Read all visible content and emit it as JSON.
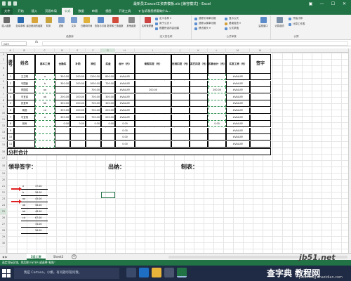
{
  "titlebar": {
    "title": "最新员工excel工资表模板.xls [兼容模式] - Excel"
  },
  "tabs": [
    "文件",
    "开始",
    "插入",
    "页面布局",
    "公式",
    "数据",
    "审阅",
    "视图",
    "开发工具",
    "♀ 告诉我您想要做什么..."
  ],
  "ribbon": {
    "function_library": {
      "label": "函数库",
      "buttons": [
        "插入函数",
        "自动求和",
        "最近使用的函数",
        "财务",
        "逻辑",
        "文本",
        "日期和时间",
        "查找与引用",
        "数学和三角函数",
        "其他函数"
      ]
    },
    "defined_names": {
      "label": "定义的名称",
      "manager": "名称管理器",
      "items": [
        "定义名称 ▾",
        "用于公式 ▾",
        "根据所选内容创建"
      ]
    },
    "formula_auditing": {
      "label": "公式审核",
      "items": [
        "追踪引用单元格",
        "追踪从属单元格",
        "移去箭头 ▾",
        "显示公式",
        "错误检查 ▾",
        "公式求值"
      ],
      "watch": "监视窗口"
    },
    "calculation": {
      "label": "计算",
      "options": "计算选项",
      "items": [
        "开始计算",
        "计算工作表"
      ]
    }
  },
  "formula_bar": {
    "name_box": "G25",
    "fx": "fx",
    "formula": ""
  },
  "columns": [
    "A",
    "B",
    "C",
    "D",
    "E",
    "F",
    "G",
    "H",
    "I",
    "J",
    "K",
    "L",
    "M",
    "N"
  ],
  "rows": [
    "1",
    "2",
    "3",
    "4",
    "5",
    "6",
    "7",
    "8",
    "9",
    "10",
    "11",
    "12",
    "13",
    "14",
    "15",
    "16",
    "17",
    "18",
    "19",
    "20",
    "21",
    "22",
    "23",
    "24",
    "25",
    "26",
    "27",
    "28",
    "29",
    "30"
  ],
  "table": {
    "headers": {
      "no": "序号",
      "name": "姓名",
      "base": "基本工资",
      "full_attend": "全勤奖",
      "subsidy": "补助",
      "post": "岗位",
      "bonus": "奖金",
      "total": "合计（元）",
      "late": "请假扣发（元）",
      "absent": "迟到扣发（元）",
      "other": "其它扣发（元）",
      "deduct_total": "扣款合计（元）",
      "actual": "实发工资（元）",
      "sign": "签字"
    },
    "rows": [
      {
        "no": "1",
        "name": "王卫明",
        "base": "a",
        "full": "350.00",
        "subsidy": "200.00",
        "post": "1200.00",
        "bonus": "800.00",
        "total": "#VALUE!",
        "late": "",
        "absent": "",
        "other": "",
        "deduct": "",
        "actual": "#VALUE!"
      },
      {
        "no": "2",
        "name": "乌国鑫",
        "base": "b",
        "full": "350.00",
        "subsidy": "200.00",
        "post": "1000.00",
        "bonus": "700.00",
        "total": "#VALUE!",
        "late": "",
        "absent": "",
        "other": "",
        "deduct": "",
        "actual": "#VALUE!"
      },
      {
        "no": "3",
        "name": "郑国斌",
        "base": "aa",
        "full": "",
        "subsidy": "",
        "post": "700.00",
        "bonus": "",
        "total": "#VALUE!",
        "late": "200.00",
        "absent": "",
        "other": "",
        "deduct": "200.00",
        "actual": "#VALUE!"
      },
      {
        "no": "4",
        "name": "乌宜省",
        "base": "ab",
        "full": "200.00",
        "subsidy": "200.00",
        "post": "700.00",
        "bonus": "300.00",
        "total": "#VALUE!",
        "late": "",
        "absent": "",
        "other": "",
        "deduct": "",
        "actual": "#VALUE!"
      },
      {
        "no": "5",
        "name": "张爱琴",
        "base": "bb",
        "full": "350.00",
        "subsidy": "200.00",
        "post": "700.00",
        "bonus": "300.00",
        "total": "#VALUE!",
        "late": "",
        "absent": "",
        "other": "",
        "deduct": "",
        "actual": "#VALUE!"
      },
      {
        "no": "6",
        "name": "蒋园",
        "base": "cd",
        "full": "350.00",
        "subsidy": "200.00",
        "post": "700.00",
        "bonus": "200.00",
        "total": "#VALUE!",
        "late": "",
        "absent": "",
        "other": "",
        "deduct": "",
        "actual": "#VALUE!"
      },
      {
        "no": "7",
        "name": "乌宜宿",
        "base": "a",
        "full": "350.00",
        "subsidy": "200.00",
        "post": "700.00",
        "bonus": "200.00",
        "total": "#VALUE!",
        "late": "",
        "absent": "",
        "other": "",
        "deduct": "",
        "actual": "#VALUE!"
      },
      {
        "no": "8",
        "name": "宫睿",
        "base": "",
        "full": "0.00",
        "subsidy": "0.00",
        "post": "0.00",
        "bonus": "0.00",
        "total": "0.00",
        "late": "",
        "absent": "",
        "other": "",
        "deduct": "0.00",
        "actual": "#VALUE!"
      },
      {
        "no": "9",
        "name": "",
        "base": "",
        "full": "",
        "subsidy": "",
        "post": "",
        "bonus": "",
        "total": "0.00",
        "late": "",
        "absent": "",
        "other": "",
        "deduct": "",
        "actual": "#VALUE!"
      },
      {
        "no": "10",
        "name": "",
        "base": "",
        "full": "",
        "subsidy": "",
        "post": "",
        "bonus": "",
        "total": "0.00",
        "late": "",
        "absent": "",
        "other": "",
        "deduct": "",
        "actual": "#VALUE!"
      },
      {
        "no": "11",
        "name": "",
        "base": "",
        "full": "",
        "subsidy": "",
        "post": "",
        "bonus": "",
        "total": "0.00",
        "late": "",
        "absent": "",
        "other": "",
        "deduct": "",
        "actual": "#VALUE!"
      }
    ],
    "subtotal": "分栏合计",
    "footer": {
      "leader": "领导签字：",
      "cashier": "出纳：",
      "maker": "制表："
    }
  },
  "lookup": [
    {
      "key": "a",
      "val": "37.00"
    },
    {
      "key": "b",
      "val": "56.00"
    },
    {
      "key": "aa",
      "val": "45.00"
    },
    {
      "key": "ab",
      "val": "56.00"
    },
    {
      "key": "bb",
      "val": "48.00"
    },
    {
      "key": "cd",
      "val": "67.00"
    },
    {
      "key": "",
      "val": "34.00"
    },
    {
      "key": "",
      "val": "56.00"
    }
  ],
  "sheets": {
    "nav": "◀ ▶",
    "tabs": [
      "5月工资",
      "Sheet3"
    ],
    "active": "5月工资",
    "add": "+"
  },
  "status": "选定目标区域，然后按 ENTER 或选择“粘贴”",
  "taskbar": {
    "search": "我是 Cortana，小娜。有问题尽管问我。"
  },
  "watermark": {
    "site": "jb51.net",
    "text": "查字典 教程网",
    "sub": "jiaocheng.chazidian.com"
  },
  "colors": {
    "excel_green": "#217346",
    "error_arrow": "#e02020"
  }
}
